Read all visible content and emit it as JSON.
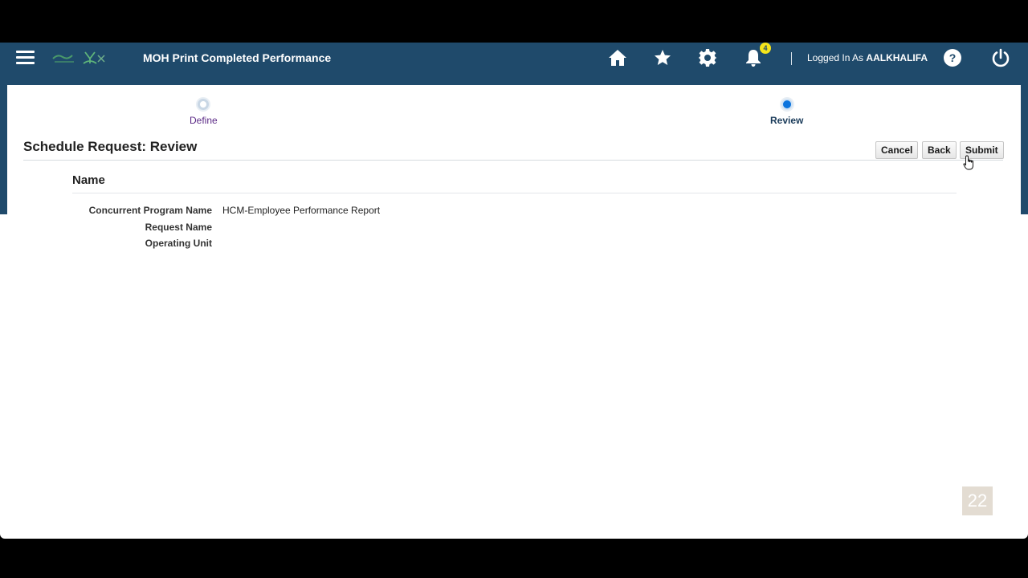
{
  "header": {
    "app_title": "MOH Print Completed Performance",
    "notification_count": "4",
    "logged_in_prefix": "Logged In As",
    "username": "AALKHALIFA",
    "icons": [
      "menu-icon",
      "home-icon",
      "star-icon",
      "gear-icon",
      "bell-icon",
      "help-icon",
      "power-icon"
    ],
    "colors": {
      "bar": "#1f4a6b",
      "badge": "#f5e51b"
    }
  },
  "train": {
    "steps": [
      {
        "label": "Define",
        "state": "visited"
      },
      {
        "label": "Review",
        "state": "current"
      }
    ]
  },
  "page": {
    "title": "Schedule Request: Review",
    "buttons": {
      "cancel": "Cancel",
      "back": "Back",
      "submit": "Submit"
    }
  },
  "section": {
    "title": "Name",
    "fields": [
      {
        "label": "Concurrent Program Name",
        "value": "HCM-Employee Performance Report"
      },
      {
        "label": "Request Name",
        "value": ""
      },
      {
        "label": "Operating Unit",
        "value": ""
      }
    ]
  },
  "overlay": {
    "page_number": "22"
  }
}
